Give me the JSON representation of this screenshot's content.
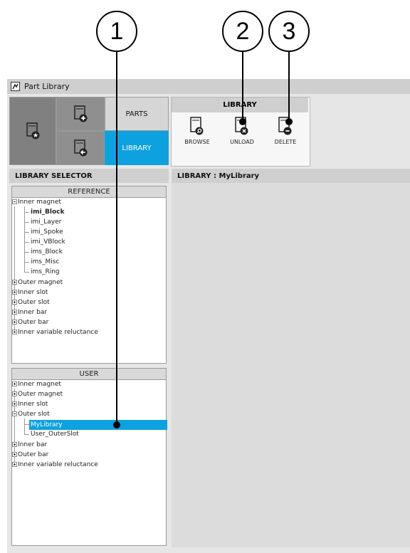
{
  "callouts": [
    "1",
    "2",
    "3"
  ],
  "window": {
    "title": "Part Library",
    "icon": "part-library-icon"
  },
  "mode_tabs": {
    "parts_label": "PARTS",
    "library_label": "LIBRARY",
    "accent": "#0ea1e0"
  },
  "library_toolbar": {
    "title": "LIBRARY",
    "buttons": [
      {
        "label": "BROWSE",
        "icon": "browse-icon"
      },
      {
        "label": "UNLOAD",
        "icon": "unload-icon"
      },
      {
        "label": "DELETE",
        "icon": "delete-icon"
      }
    ]
  },
  "library_selector": {
    "title": "LIBRARY SELECTOR",
    "reference": {
      "header": "REFERENCE",
      "items": [
        "Inner magnet",
        "imi_Block",
        "imi_Layer",
        "imi_Spoke",
        "imi_VBlock",
        "ims_Block",
        "ims_Misc",
        "ims_Ring",
        "Outer magnet",
        "Inner slot",
        "Outer slot",
        "Inner bar",
        "Outer bar",
        "Inner variable reluctance"
      ]
    },
    "user": {
      "header": "USER",
      "items": [
        "Inner magnet",
        "Outer magnet",
        "Inner slot",
        "Outer slot",
        "MyLibrary",
        "User_OuterSlot",
        "Inner bar",
        "Outer bar",
        "Inner variable reluctance"
      ],
      "selected": "MyLibrary"
    }
  },
  "library_view": {
    "title": "LIBRARY : MyLibrary"
  }
}
